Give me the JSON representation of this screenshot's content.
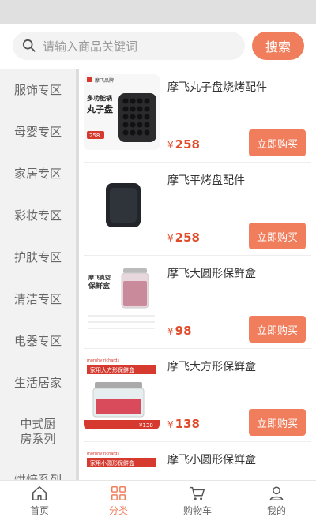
{
  "search": {
    "placeholder": "请输入商品关键词",
    "button_label": "搜索"
  },
  "sidebar": {
    "items": [
      {
        "label": "服饰专区"
      },
      {
        "label": "母婴专区"
      },
      {
        "label": "家居专区"
      },
      {
        "label": "彩妆专区"
      },
      {
        "label": "护肤专区"
      },
      {
        "label": "清洁专区"
      },
      {
        "label": "电器专区"
      },
      {
        "label": "生活居家"
      },
      {
        "label": "中式厨房系列"
      },
      {
        "label": "烘焙系列"
      }
    ]
  },
  "products": [
    {
      "title": "摩飞丸子盘烧烤配件",
      "currency": "¥",
      "price": "258",
      "buy_label": "立即购买",
      "thumb_text": {
        "brand": "摩飞品牌",
        "line1": "多功能锅",
        "line2": "丸子盘",
        "badge": "258"
      }
    },
    {
      "title": "摩飞平烤盘配件",
      "currency": "¥",
      "price": "258",
      "buy_label": "立即购买"
    },
    {
      "title": "摩飞大圆形保鲜盒",
      "currency": "¥",
      "price": "98",
      "buy_label": "立即购买",
      "thumb_text": {
        "line1": "摩飞真空",
        "line2": "保鲜盒"
      }
    },
    {
      "title": "摩飞大方形保鲜盒",
      "currency": "¥",
      "price": "138",
      "buy_label": "立即购买",
      "thumb_text": {
        "brand": "morphy richards",
        "line1": "家用大方形保鲜盒",
        "badge": "¥138"
      }
    },
    {
      "title": "摩飞小圆形保鲜盒",
      "thumb_text": {
        "brand": "morphy richards",
        "line1": "家用小圆形保鲜盒"
      }
    }
  ],
  "tabbar": {
    "tabs": [
      {
        "label": "首页",
        "icon": "home-icon"
      },
      {
        "label": "分类",
        "icon": "category-icon",
        "active": true
      },
      {
        "label": "购物车",
        "icon": "cart-icon"
      },
      {
        "label": "我的",
        "icon": "user-icon"
      }
    ]
  },
  "colors": {
    "accent": "#f07d5c",
    "price": "#e04b2a",
    "sidebar_bg": "#f2f2f2"
  }
}
